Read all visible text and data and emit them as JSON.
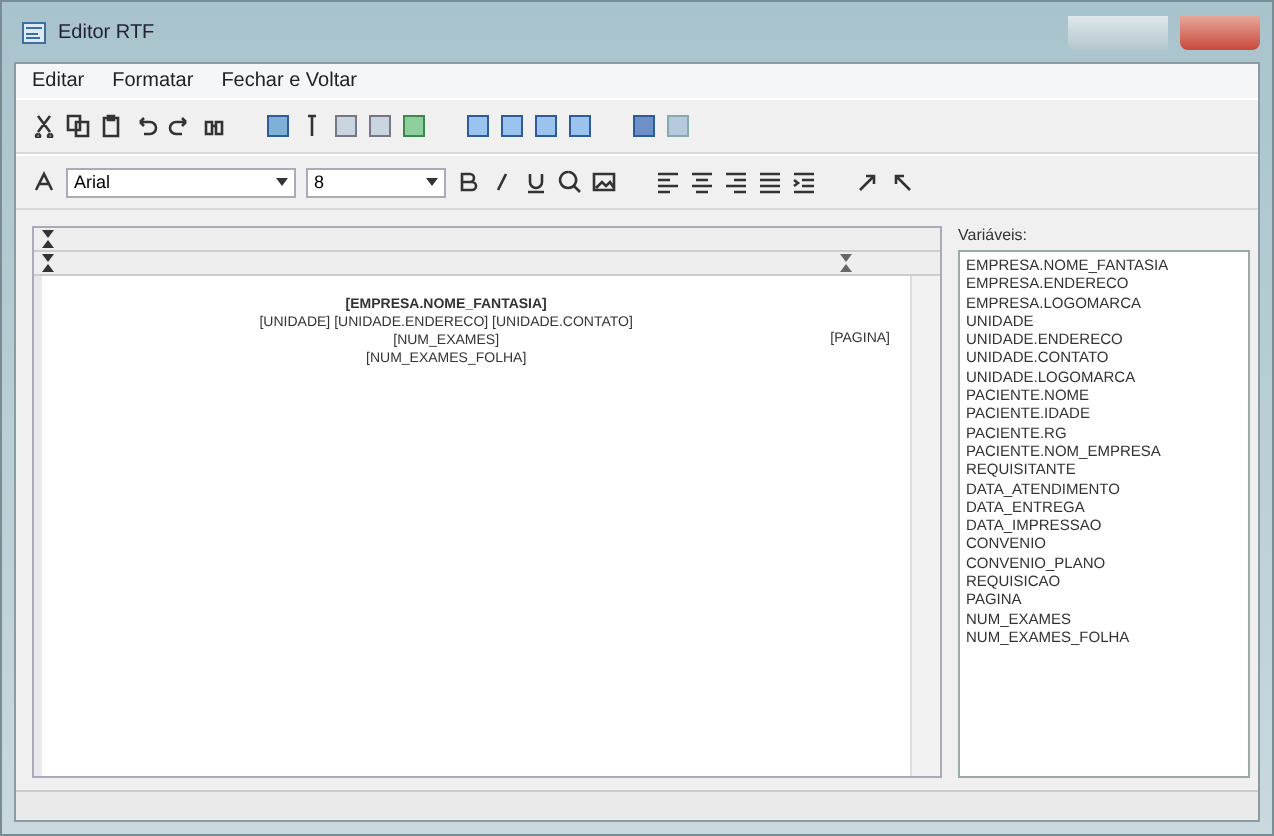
{
  "window": {
    "title": "Editor RTF"
  },
  "menu": [
    "Editar",
    "Formatar",
    "Fechar e Voltar"
  ],
  "format_bar": {
    "font": "Arial",
    "size": "8"
  },
  "document": {
    "lines": [
      {
        "text": "[EMPRESA.NOME_FANTASIA]",
        "kind": "bold"
      },
      {
        "text": "[UNIDADE] [UNIDADE.ENDERECO] [UNIDADE.CONTATO]",
        "kind": "plain"
      },
      {
        "text": "[NUM_EXAMES]",
        "kind": "plain"
      },
      {
        "text": "[NUM_EXAMES_FOLHA]",
        "kind": "plain"
      }
    ],
    "side_text": "[PAGINA]"
  },
  "variables": {
    "label": "Variáveis:",
    "items": [
      "EMPRESA.NOME_FANTASIA",
      "EMPRESA.ENDERECO",
      "EMPRESA.LOGOMARCA",
      "UNIDADE",
      "UNIDADE.ENDERECO",
      "UNIDADE.CONTATO",
      "UNIDADE.LOGOMARCA",
      "PACIENTE.NOME",
      "PACIENTE.IDADE",
      "PACIENTE.RG",
      "PACIENTE.NOM_EMPRESA",
      "REQUISITANTE",
      "DATA_ATENDIMENTO",
      "DATA_ENTREGA",
      "DATA_IMPRESSAO",
      "CONVENIO",
      "CONVENIO_PLANO",
      "REQUISICAO",
      "PAGINA",
      "NUM_EXAMES",
      "NUM_EXAMES_FOLHA"
    ]
  }
}
